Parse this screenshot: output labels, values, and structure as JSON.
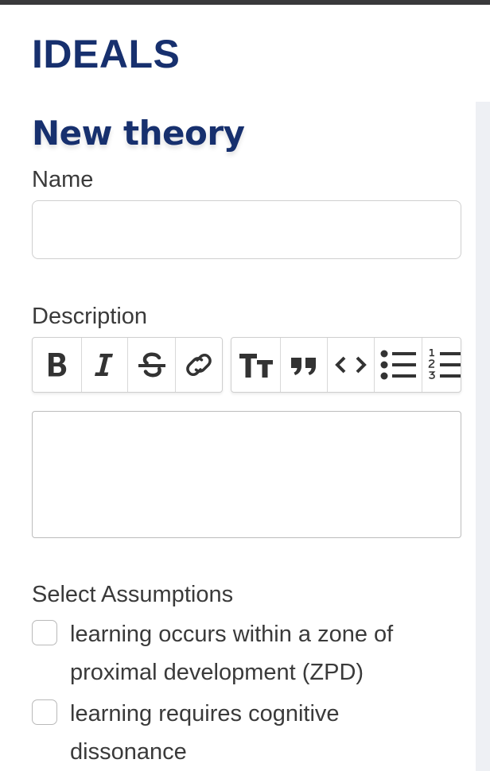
{
  "header": {
    "brand": "IDEALS"
  },
  "form": {
    "title": "New theory",
    "name_label": "Name",
    "name_value": "",
    "description_label": "Description",
    "toolbar": [
      {
        "icon": "bold-icon",
        "label": "Bold"
      },
      {
        "icon": "italic-icon",
        "label": "Italic"
      },
      {
        "icon": "strikethrough-icon",
        "label": "Strikethrough"
      },
      {
        "icon": "link-icon",
        "label": "Link"
      },
      {
        "icon": "heading-icon",
        "label": "Heading"
      },
      {
        "icon": "quote-icon",
        "label": "Quote"
      },
      {
        "icon": "code-icon",
        "label": "Code"
      },
      {
        "icon": "bullet-list-icon",
        "label": "Bulleted list"
      },
      {
        "icon": "numbered-list-icon",
        "label": "Numbered list"
      }
    ],
    "description_value": "",
    "assumptions_label": "Select Assumptions",
    "assumptions": [
      {
        "label": "learning occurs within a zone of proximal development (ZPD)",
        "checked": false
      },
      {
        "label": "learning requires cognitive dissonance",
        "checked": false
      }
    ]
  }
}
